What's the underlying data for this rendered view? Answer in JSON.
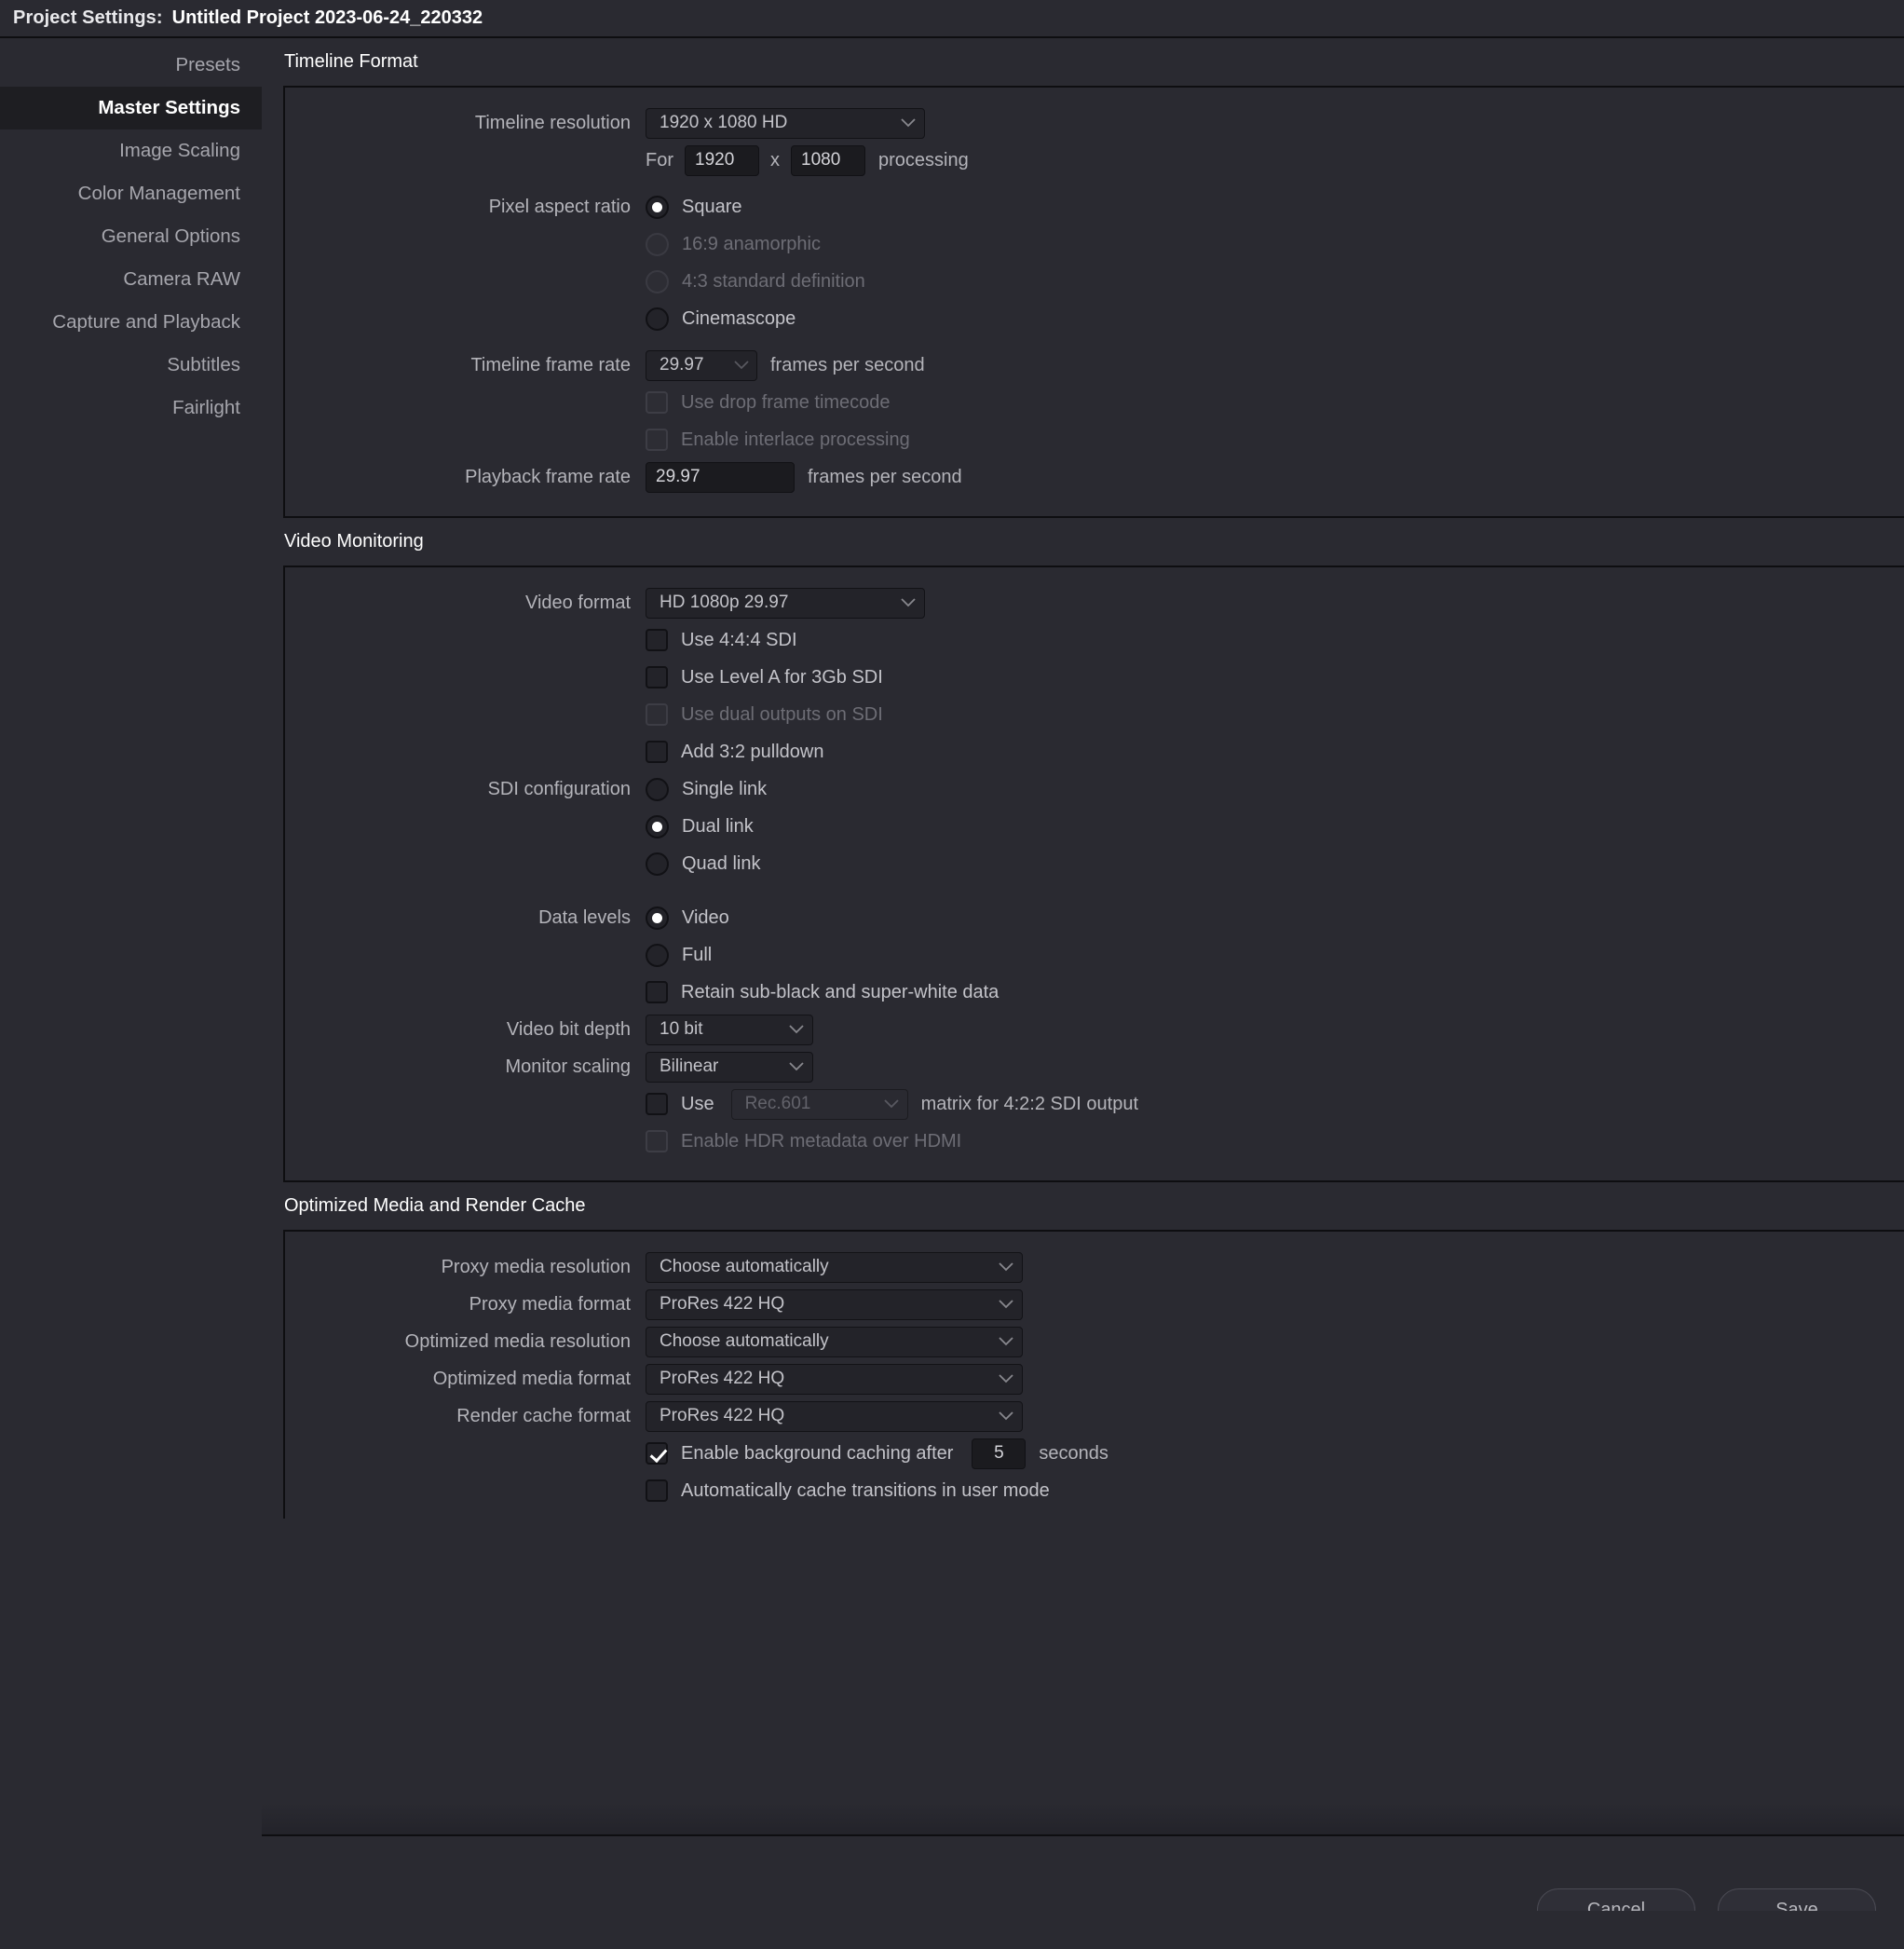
{
  "titlebar": {
    "label": "Project Settings:",
    "project_name": "Untitled Project 2023-06-24_220332"
  },
  "sidebar": {
    "items": [
      {
        "label": "Presets",
        "active": false
      },
      {
        "label": "Master Settings",
        "active": true
      },
      {
        "label": "Image Scaling",
        "active": false
      },
      {
        "label": "Color Management",
        "active": false
      },
      {
        "label": "General Options",
        "active": false
      },
      {
        "label": "Camera RAW",
        "active": false
      },
      {
        "label": "Capture and Playback",
        "active": false
      },
      {
        "label": "Subtitles",
        "active": false
      },
      {
        "label": "Fairlight",
        "active": false
      }
    ]
  },
  "timeline_format": {
    "section_title": "Timeline Format",
    "timeline_resolution_label": "Timeline resolution",
    "timeline_resolution_value": "1920 x 1080 HD",
    "for_label": "For",
    "width_value": "1920",
    "x_label": "x",
    "height_value": "1080",
    "processing_label": "processing",
    "pixel_aspect_label": "Pixel aspect ratio",
    "pixel_aspect_options": [
      {
        "label": "Square",
        "selected": true,
        "disabled": false
      },
      {
        "label": "16:9 anamorphic",
        "selected": false,
        "disabled": true
      },
      {
        "label": "4:3 standard definition",
        "selected": false,
        "disabled": true
      },
      {
        "label": "Cinemascope",
        "selected": false,
        "disabled": false
      }
    ],
    "timeline_frame_rate_label": "Timeline frame rate",
    "timeline_frame_rate_value": "29.97",
    "fps_label": "frames per second",
    "drop_frame_label": "Use drop frame timecode",
    "interlace_label": "Enable interlace processing",
    "playback_frame_rate_label": "Playback frame rate",
    "playback_frame_rate_value": "29.97",
    "playback_fps_label": "frames per second"
  },
  "video_monitoring": {
    "section_title": "Video Monitoring",
    "video_format_label": "Video format",
    "video_format_value": "HD 1080p 29.97",
    "use_444_sdi_label": "Use 4:4:4 SDI",
    "use_level_a_label": "Use Level A for 3Gb SDI",
    "use_dual_outputs_label": "Use dual outputs on SDI",
    "add_32_pulldown_label": "Add 3:2 pulldown",
    "sdi_configuration_label": "SDI configuration",
    "sdi_options": [
      {
        "label": "Single link",
        "selected": false
      },
      {
        "label": "Dual link",
        "selected": true
      },
      {
        "label": "Quad link",
        "selected": false
      }
    ],
    "data_levels_label": "Data levels",
    "data_levels_options": [
      {
        "label": "Video",
        "selected": true
      },
      {
        "label": "Full",
        "selected": false
      }
    ],
    "retain_subblack_label": "Retain sub-black and super-white data",
    "video_bit_depth_label": "Video bit depth",
    "video_bit_depth_value": "10 bit",
    "monitor_scaling_label": "Monitor scaling",
    "monitor_scaling_value": "Bilinear",
    "use_label": "Use",
    "matrix_value": "Rec.601",
    "matrix_suffix_label": "matrix for 4:2:2 SDI output",
    "enable_hdr_label": "Enable HDR metadata over HDMI"
  },
  "optimized_media": {
    "section_title": "Optimized Media and Render Cache",
    "rows": [
      {
        "label": "Proxy media resolution",
        "value": "Choose automatically"
      },
      {
        "label": "Proxy media format",
        "value": "ProRes 422 HQ"
      },
      {
        "label": "Optimized media resolution",
        "value": "Choose automatically"
      },
      {
        "label": "Optimized media format",
        "value": "ProRes 422 HQ"
      },
      {
        "label": "Render cache format",
        "value": "ProRes 422 HQ"
      }
    ],
    "background_caching_label": "Enable background caching after",
    "background_caching_seconds": "5",
    "seconds_label": "seconds",
    "auto_cache_transitions_label": "Automatically cache transitions in user mode"
  },
  "footer": {
    "cancel_label": "Cancel",
    "save_label": "Save"
  },
  "colors": {
    "window_bg": "#2a2a31",
    "panel_border": "#0e0e11",
    "active_sidebar": "#1e1e22",
    "text_primary": "#ffffff",
    "text_secondary": "#b4b4ba",
    "text_disabled": "#6d6d75"
  }
}
